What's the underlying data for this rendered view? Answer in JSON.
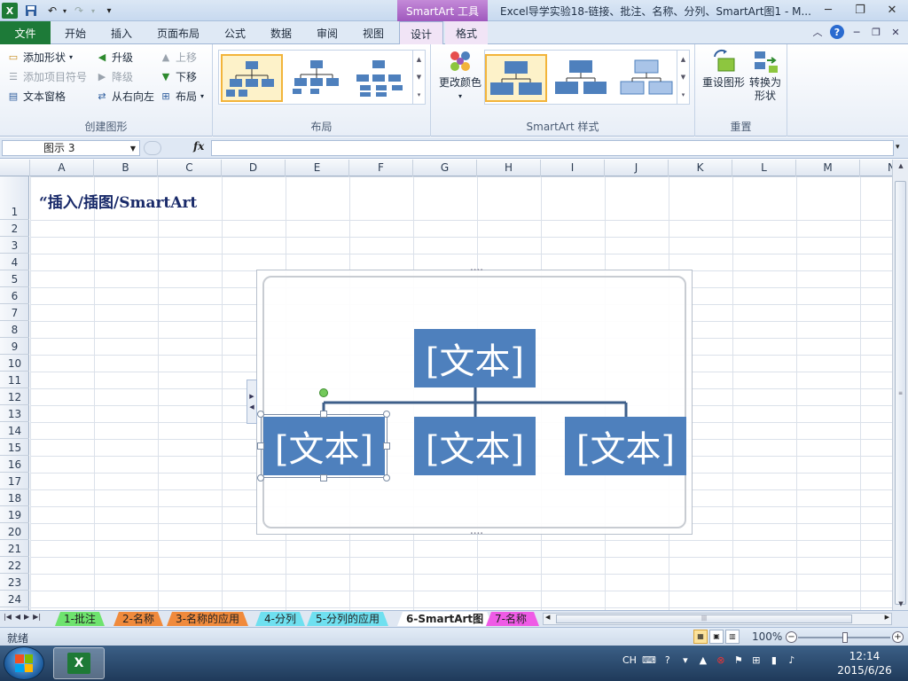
{
  "titlebar": {
    "context_tab_group": "SmartArt 工具",
    "window_title": "Excel导学实验18-链接、批注、名称、分列、SmartArt图1 - M..."
  },
  "tabs": {
    "file": "文件",
    "items": [
      "开始",
      "插入",
      "页面布局",
      "公式",
      "数据",
      "审阅",
      "视图",
      "设计",
      "格式"
    ],
    "active": "设计"
  },
  "ribbon": {
    "create_graphic": {
      "label": "创建图形",
      "add_shape": "添加形状",
      "add_bullet": "添加项目符号",
      "text_pane": "文本窗格",
      "promote": "升级",
      "demote": "降级",
      "right_to_left": "从右向左",
      "move_up": "上移",
      "move_down": "下移",
      "layout": "布局"
    },
    "layouts": {
      "label": "布局"
    },
    "styles": {
      "label": "SmartArt 样式",
      "change_colors": "更改颜色"
    },
    "reset": {
      "label": "重置",
      "reset_graphic": "重设图形",
      "convert_line1": "转换为",
      "convert_line2": "形状"
    }
  },
  "formula_bar": {
    "name_box": "图示 3",
    "fx": "fx",
    "value": ""
  },
  "sheet": {
    "columns": [
      "A",
      "B",
      "C",
      "D",
      "E",
      "F",
      "G",
      "H",
      "I",
      "J",
      "K",
      "L",
      "M",
      "N"
    ],
    "rows": [
      "1",
      "2",
      "3",
      "4",
      "5",
      "6",
      "7",
      "8",
      "9",
      "10",
      "11",
      "12",
      "13",
      "14",
      "15",
      "16",
      "17",
      "18",
      "19",
      "20",
      "21",
      "22",
      "23",
      "24"
    ],
    "a1_text": "“插入/插图/SmartArt"
  },
  "smartart": {
    "top": "[文本]",
    "child1": "[文本]",
    "child2": "[文本]",
    "child3": "[文本]",
    "fill_color": "#4e80bd",
    "line_color": "#3e5f8a"
  },
  "sheet_tabs": [
    {
      "label": "1-批注",
      "color": "#6ee36e"
    },
    {
      "label": "2-名称",
      "color": "#f08a3c"
    },
    {
      "label": "3-名称的应用",
      "color": "#f08a3c"
    },
    {
      "label": "4-分列",
      "color": "#6fe0f0"
    },
    {
      "label": "5-分列的应用",
      "color": "#6fe0f0"
    },
    {
      "label": "6-SmartArt图",
      "color": "#ffffff"
    },
    {
      "label": "7-名称",
      "color": "#ef5be6"
    }
  ],
  "status": {
    "ready": "就绪",
    "zoom": "100%"
  },
  "taskbar": {
    "lang": "CH",
    "time": "12:14",
    "date": "2015/6/26"
  }
}
